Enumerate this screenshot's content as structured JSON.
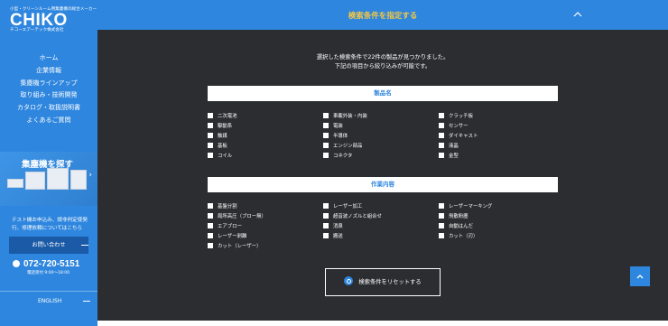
{
  "brand": {
    "tagline": "小型・クリーンルーム用集塵機の総合メーカー",
    "name": "CHIKO",
    "company": "チコーエアーテック株式会社"
  },
  "nav": {
    "items": [
      "ホーム",
      "企業情報",
      "集塵機ラインアップ",
      "取り組み・技術開発",
      "カタログ・取扱説明書",
      "よくあるご質問"
    ]
  },
  "search_banner": {
    "title": "集塵機を探す"
  },
  "contact": {
    "text": "テスト機お申込み、誤非判定使発行、修理依頼についてはこちら",
    "button_label": "お問い合わせ",
    "phone": "072-720-5151",
    "hours": "電話受付 9:00～18:00"
  },
  "language": {
    "label": "ENGLISH"
  },
  "header": {
    "title": "検索条件を指定する"
  },
  "result": {
    "line1": "選択した検索条件で22件の製品が見つかりました。",
    "line2": "下記の項目から絞り込みが可能です。"
  },
  "sections": {
    "product": {
      "title": "製品名",
      "options": [
        "二次電池",
        "車載外装・内装",
        "クラッチ板",
        "駆動系",
        "電装",
        "センサー",
        "触媒",
        "半導体",
        "ダイキャスト",
        "基板",
        "エンジン部品",
        "液晶",
        "コイル",
        "コネクタ",
        "金型"
      ]
    },
    "work": {
      "title": "作業内容",
      "options": [
        "基盤分割",
        "レーザー加工",
        "レーザーマーキング",
        "局所高圧（ブロー無）",
        "超音波ノズルと組合せ",
        "飛散粉塵",
        "エアブロー",
        "消泉",
        "自動はんだ",
        "レーザー剥離",
        "搬送",
        "カット（刃）",
        "カット（レーザー）"
      ]
    }
  },
  "reset": {
    "label": "検索条件をリセットする"
  },
  "colors": {
    "primary": "#2e86de",
    "accent": "#f5c842",
    "main_bg": "#2b2d30"
  },
  "icons": {
    "collapse": "chevron-up-icon",
    "scroll_top": "chevron-up-icon",
    "reset": "reset-icon",
    "phone": "phone-icon"
  }
}
